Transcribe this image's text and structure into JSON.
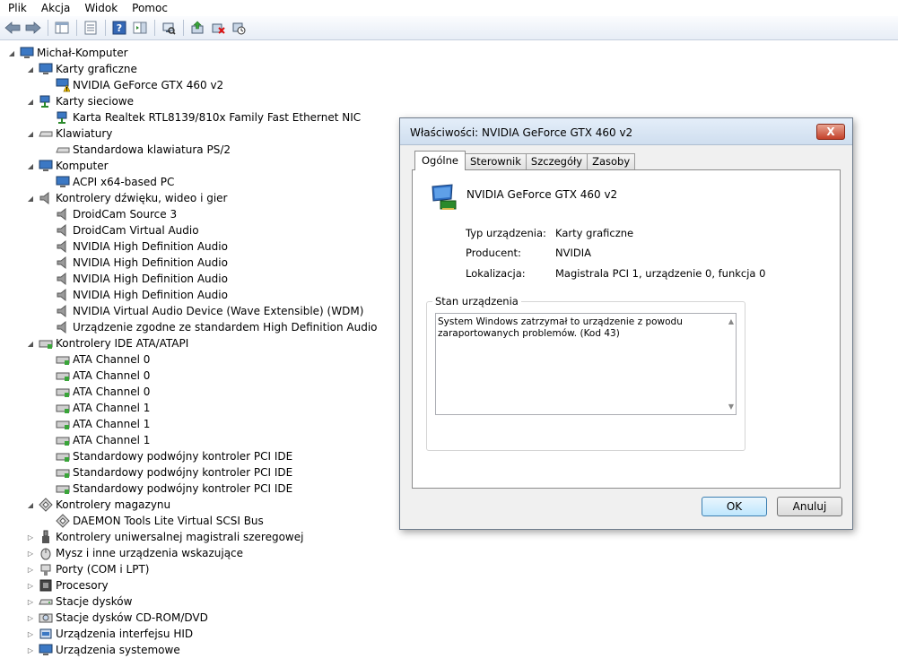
{
  "menu": [
    "Plik",
    "Akcja",
    "Widok",
    "Pomoc"
  ],
  "toolbar": [
    "back-icon",
    "forward-icon",
    "show-hide-tree-icon",
    "properties-icon",
    "help-icon",
    "action-pane-icon",
    "scan-hardware-icon",
    "update-driver-icon",
    "uninstall-icon",
    "disable-icon"
  ],
  "tree": {
    "root": "Michał-Komputer",
    "categories": {
      "karty_graficzne": "Karty graficzne",
      "karty_sieciowe": "Karty sieciowe",
      "klawiatury": "Klawiatury",
      "komputer": "Komputer",
      "dzwiek": "Kontrolery dźwięku, wideo i gier",
      "ide": "Kontrolery IDE ATA/ATAPI",
      "magazyn": "Kontrolery magazynu",
      "usb": "Kontrolery uniwersalnej magistrali szeregowej",
      "mysz": "Mysz i inne urządzenia wskazujące",
      "porty": "Porty (COM i LPT)",
      "procesory": "Procesory",
      "stacje": "Stacje dysków",
      "cdrom": "Stacje dysków CD-ROM/DVD",
      "hid": "Urządzenia interfejsu HID",
      "systemowe": "Urządzenia systemowe"
    },
    "devices": {
      "gpu": "NVIDIA GeForce GTX 460 v2",
      "nic": "Karta Realtek RTL8139/810x Family Fast Ethernet NIC",
      "kbd": "Standardowa klawiatura PS/2",
      "acpi": "ACPI x64-based PC",
      "audio": [
        "DroidCam Source 3",
        "DroidCam Virtual Audio",
        "NVIDIA High Definition Audio",
        "NVIDIA High Definition Audio",
        "NVIDIA High Definition Audio",
        "NVIDIA High Definition Audio",
        "NVIDIA Virtual Audio Device (Wave Extensible) (WDM)",
        "Urządzenie zgodne ze standardem High Definition Audio"
      ],
      "ide": [
        "ATA Channel 0",
        "ATA Channel 0",
        "ATA Channel 0",
        "ATA Channel 1",
        "ATA Channel 1",
        "ATA Channel 1",
        "Standardowy podwójny kontroler PCI IDE",
        "Standardowy podwójny kontroler PCI IDE",
        "Standardowy podwójny kontroler PCI IDE"
      ],
      "scsi": "DAEMON Tools Lite Virtual SCSI Bus"
    }
  },
  "dialog": {
    "title": "Właściwości: NVIDIA GeForce GTX 460 v2",
    "close": "X",
    "tabs": [
      "Ogólne",
      "Sterownik",
      "Szczegóły",
      "Zasoby"
    ],
    "device_name": "NVIDIA GeForce GTX 460 v2",
    "props": {
      "type_label": "Typ urządzenia:",
      "type_value": "Karty graficzne",
      "maker_label": "Producent:",
      "maker_value": "NVIDIA",
      "loc_label": "Lokalizacja:",
      "loc_value": "Magistrala PCI 1, urządzenie 0, funkcja 0"
    },
    "status_title": "Stan urządzenia",
    "status_text": "System Windows zatrzymał to urządzenie z powodu zaraportowanych problemów. (Kod 43)",
    "ok": "OK",
    "cancel": "Anuluj"
  },
  "colors": {
    "title_bg": "#cfdeef",
    "close_red": "#c4412a",
    "warning": "#f2c200"
  }
}
